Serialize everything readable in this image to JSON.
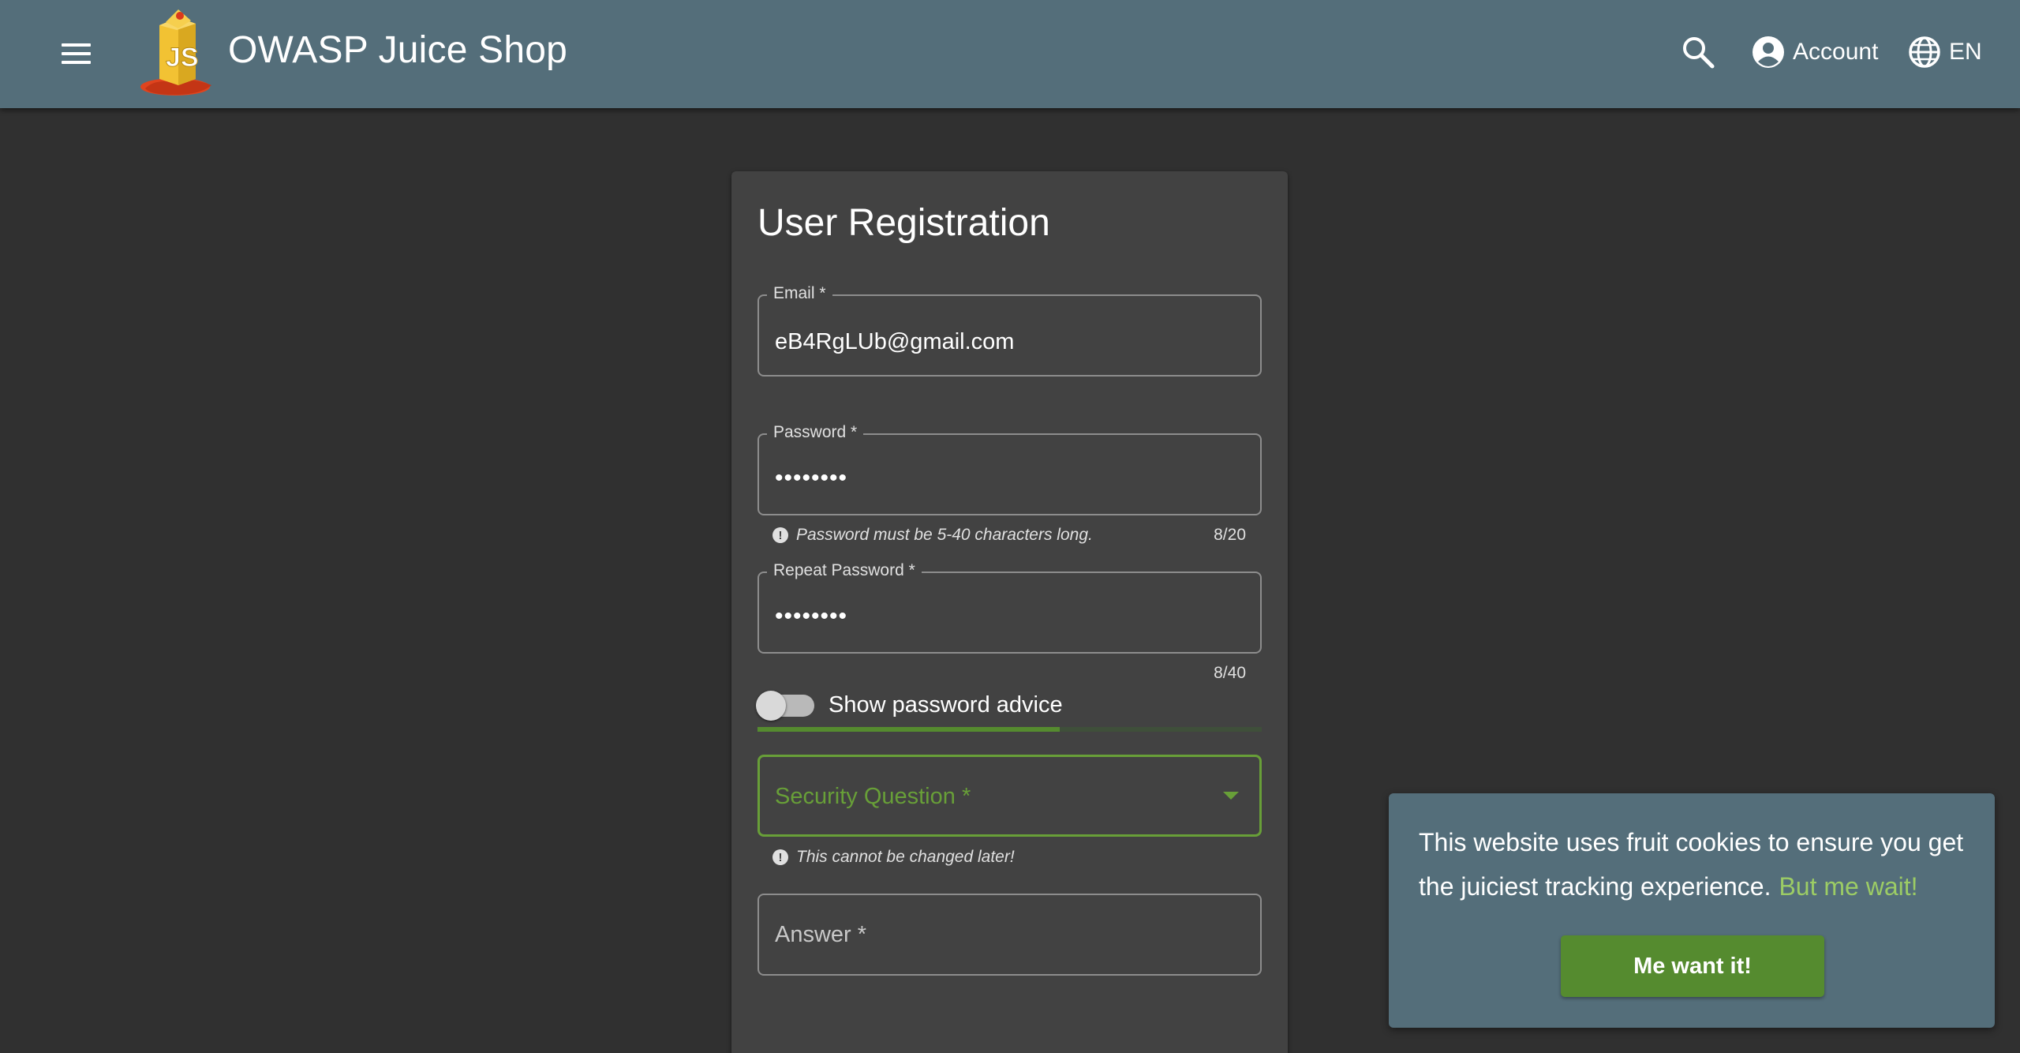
{
  "toolbar": {
    "title": "OWASP Juice Shop",
    "account_label": "Account",
    "language_label": "EN",
    "logo_text": "JS",
    "icons": {
      "menu": "menu-icon",
      "search": "search-icon",
      "account": "account-circle-icon",
      "language": "globe-icon"
    }
  },
  "registration": {
    "title": "User Registration",
    "email": {
      "label": "Email *",
      "value": "eB4RgLUb@gmail.com"
    },
    "password": {
      "label": "Password *",
      "value": "••••••••",
      "hint": "Password must be 5-40 characters long.",
      "counter": "8/20"
    },
    "repeat_password": {
      "label": "Repeat Password *",
      "value": "••••••••",
      "counter": "8/40"
    },
    "password_advice": {
      "label": "Show password advice",
      "enabled": false
    },
    "strength": {
      "fraction": 0.6
    },
    "security_question": {
      "placeholder": "Security Question *",
      "hint": "This cannot be changed later!"
    },
    "answer": {
      "placeholder": "Answer *"
    }
  },
  "cookie_banner": {
    "message": "This website uses fruit cookies to ensure you get the juiciest tracking experience.",
    "link_label": "But me wait!",
    "dismiss_label": "Me want it!"
  },
  "colors": {
    "toolbar": "#546e7a",
    "background": "#303030",
    "card": "#424242",
    "accent_green": "#689f38",
    "button_green": "#558b2f",
    "link_green": "#9ccc65"
  }
}
